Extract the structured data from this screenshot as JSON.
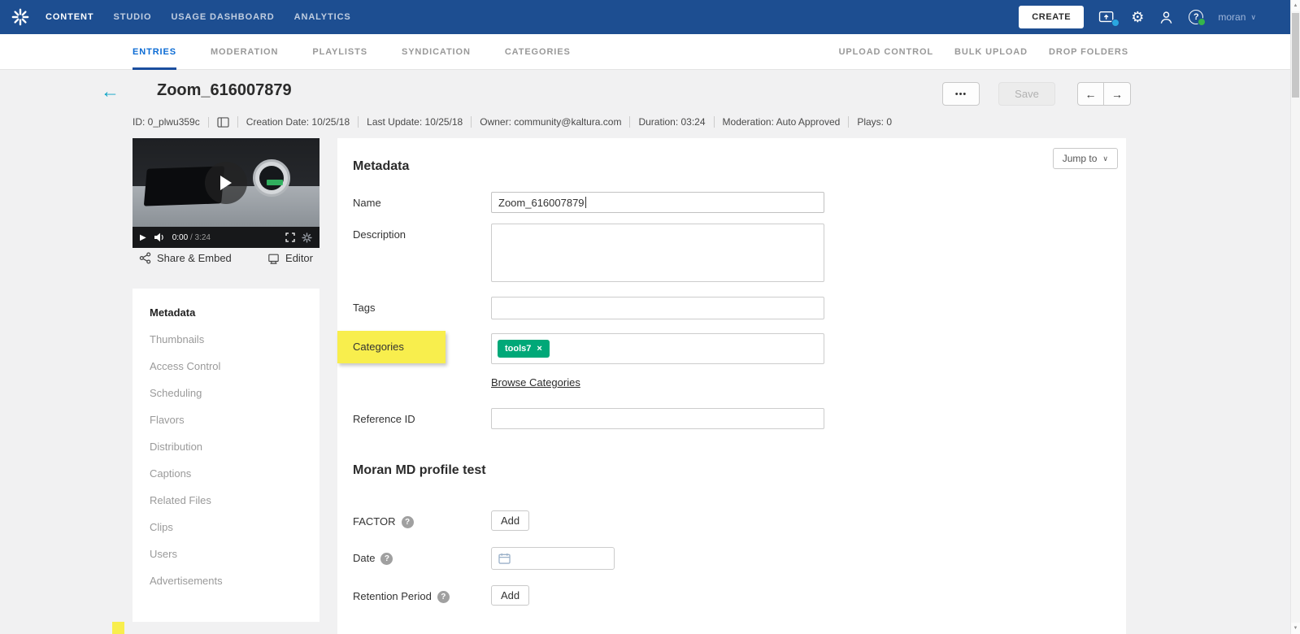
{
  "topnav": {
    "items": [
      {
        "label": "CONTENT"
      },
      {
        "label": "STUDIO"
      },
      {
        "label": "USAGE DASHBOARD"
      },
      {
        "label": "ANALYTICS"
      }
    ],
    "create_label": "CREATE",
    "user_name": "moran"
  },
  "subnav": {
    "tabs": [
      {
        "label": "ENTRIES"
      },
      {
        "label": "MODERATION"
      },
      {
        "label": "PLAYLISTS"
      },
      {
        "label": "SYNDICATION"
      },
      {
        "label": "CATEGORIES"
      }
    ],
    "right_links": [
      {
        "label": "UPLOAD CONTROL"
      },
      {
        "label": "BULK UPLOAD"
      },
      {
        "label": "DROP FOLDERS"
      }
    ]
  },
  "entry": {
    "title": "Zoom_616007879",
    "info": {
      "id": "ID: 0_plwu359c",
      "creation_date": "Creation Date: 10/25/18",
      "last_update": "Last Update: 10/25/18",
      "owner": "Owner: community@kaltura.com",
      "duration": "Duration: 03:24",
      "moderation": "Moderation: Auto Approved",
      "plays": "Plays: 0"
    },
    "save_label": "Save"
  },
  "player": {
    "current_time": "0:00",
    "total_time": "/ 3:24",
    "share_embed_label": "Share & Embed",
    "editor_label": "Editor"
  },
  "sections": [
    "Metadata",
    "Thumbnails",
    "Access Control",
    "Scheduling",
    "Flavors",
    "Distribution",
    "Captions",
    "Related Files",
    "Clips",
    "Users",
    "Advertisements"
  ],
  "form": {
    "heading": "Metadata",
    "jump_to_label": "Jump to",
    "name": {
      "label": "Name",
      "value": "Zoom_616007879"
    },
    "description": {
      "label": "Description",
      "value": ""
    },
    "tags": {
      "label": "Tags",
      "value": ""
    },
    "categories": {
      "label": "Categories",
      "chip": "tools7"
    },
    "browse_categories_label": "Browse Categories",
    "reference_id": {
      "label": "Reference ID",
      "value": ""
    }
  },
  "custom_schema": {
    "heading": "Moran MD profile test",
    "factor": {
      "label": "FACTOR",
      "button": "Add"
    },
    "date": {
      "label": "Date"
    },
    "retention": {
      "label": "Retention Period",
      "button": "Add"
    }
  },
  "icons": {
    "more": "•••",
    "back": "←",
    "prev": "←",
    "next": "→",
    "gear": "⚙",
    "chevron_down": "∨",
    "close": "×",
    "question": "?",
    "play_small": "▶",
    "scroll_up": "▲",
    "scroll_down": "▼"
  },
  "colors": {
    "topnav_bg": "#1d4e91",
    "active_tab_text": "#0b6bd4",
    "active_tab_underline": "#1a4e9e",
    "chip_green": "#00a878",
    "highlight_yellow": "#f8ee4d",
    "back_arrow_teal": "#09a2c5",
    "page_bg": "#f1f1f2"
  }
}
